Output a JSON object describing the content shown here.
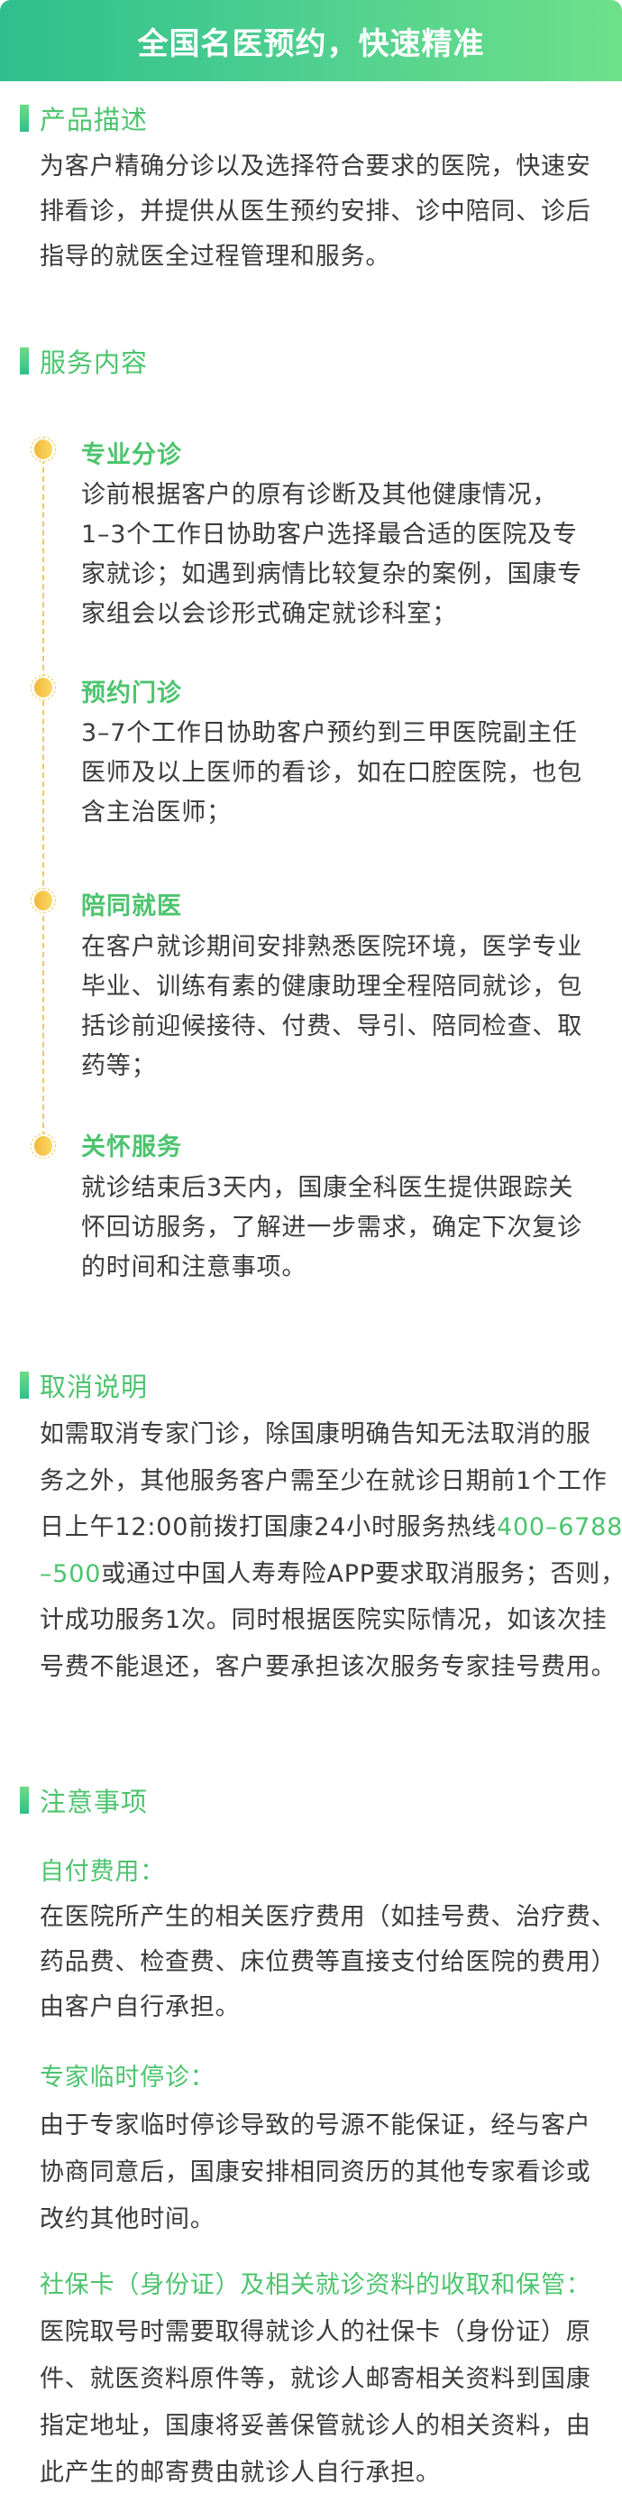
{
  "header": {
    "title": "全国名医预约，快速精准"
  },
  "colors": {
    "accent_green": "#4cc46e",
    "header_gradient": [
      "#2ebf8e",
      "#6ee08a"
    ],
    "timeline_gold": "#f2c75a",
    "body_text": "#3a3a3a"
  },
  "product": {
    "heading": "产品描述",
    "lines": [
      "为客户精确分诊以及选择符合要求的医院，快速安",
      "排看诊，并提供从医生预约安排、诊中陪同、诊后",
      "指导的就医全过程管理和服务。"
    ]
  },
  "services": {
    "heading": "服务内容",
    "items": [
      {
        "title": "专业分诊",
        "icon": "gold-dot-icon",
        "lines": [
          "诊前根据客户的原有诊断及其他健康情况，",
          "1–3个工作日协助客户选择最合适的医院及专",
          "家就诊；如遇到病情比较复杂的案例，国康专",
          "家组会以会诊形式确定就诊科室；"
        ]
      },
      {
        "title": "预约门诊",
        "icon": "gold-dot-icon",
        "lines": [
          "3–7个工作日协助客户预约到三甲医院副主任",
          "医师及以上医师的看诊，如在口腔医院，也包",
          "含主治医师；"
        ]
      },
      {
        "title": "陪同就医",
        "icon": "gold-dot-icon",
        "lines": [
          "在客户就诊期间安排熟悉医院环境，医学专业",
          "毕业、训练有素的健康助理全程陪同就诊，包",
          "括诊前迎候接待、付费、导引、陪同检查、取",
          "药等；"
        ]
      },
      {
        "title": "关怀服务",
        "icon": "gold-dot-icon",
        "lines": [
          "就诊结束后3天内，国康全科医生提供跟踪关",
          "怀回访服务，了解进一步需求，确定下次复诊",
          "的时间和注意事项。"
        ]
      }
    ]
  },
  "cancel": {
    "heading": "取消说明",
    "lines": [
      "如需取消专家门诊，除国康明确告知无法取消的服",
      "务之外，其他服务客户需至少在就诊日期前1个工作"
    ],
    "line3_text": "日上午12:00前拨打国康24小时服务热线",
    "hotline_part1": "400–6788",
    "hotline_part2": "–500",
    "line4_text": "或通过中国人寿寿险APP要求取消服务；否则，",
    "lines_after": [
      "计成功服务1次。同时根据医院实际情况，如该次挂",
      "号费不能退还，客户要承担该次服务专家挂号费用。"
    ]
  },
  "notes": {
    "heading": "注意事项",
    "items": [
      {
        "title": "自付费用：",
        "lines": [
          "在医院所产生的相关医疗费用（如挂号费、治疗费、",
          "药品费、检查费、床位费等直接支付给医院的费用）",
          "由客户自行承担。"
        ]
      },
      {
        "title": "专家临时停诊：",
        "lines": [
          "由于专家临时停诊导致的号源不能保证，经与客户",
          "协商同意后，国康安排相同资历的其他专家看诊或",
          "改约其他时间。"
        ]
      },
      {
        "title": "社保卡（身份证）及相关就诊资料的收取和保管：",
        "lines": [
          "医院取号时需要取得就诊人的社保卡（身份证）原",
          "件、就医资料原件等，就诊人邮寄相关资料到国康",
          "指定地址，国康将妥善保管就诊人的相关资料，由",
          "此产生的邮寄费由就诊人自行承担。"
        ]
      }
    ]
  }
}
